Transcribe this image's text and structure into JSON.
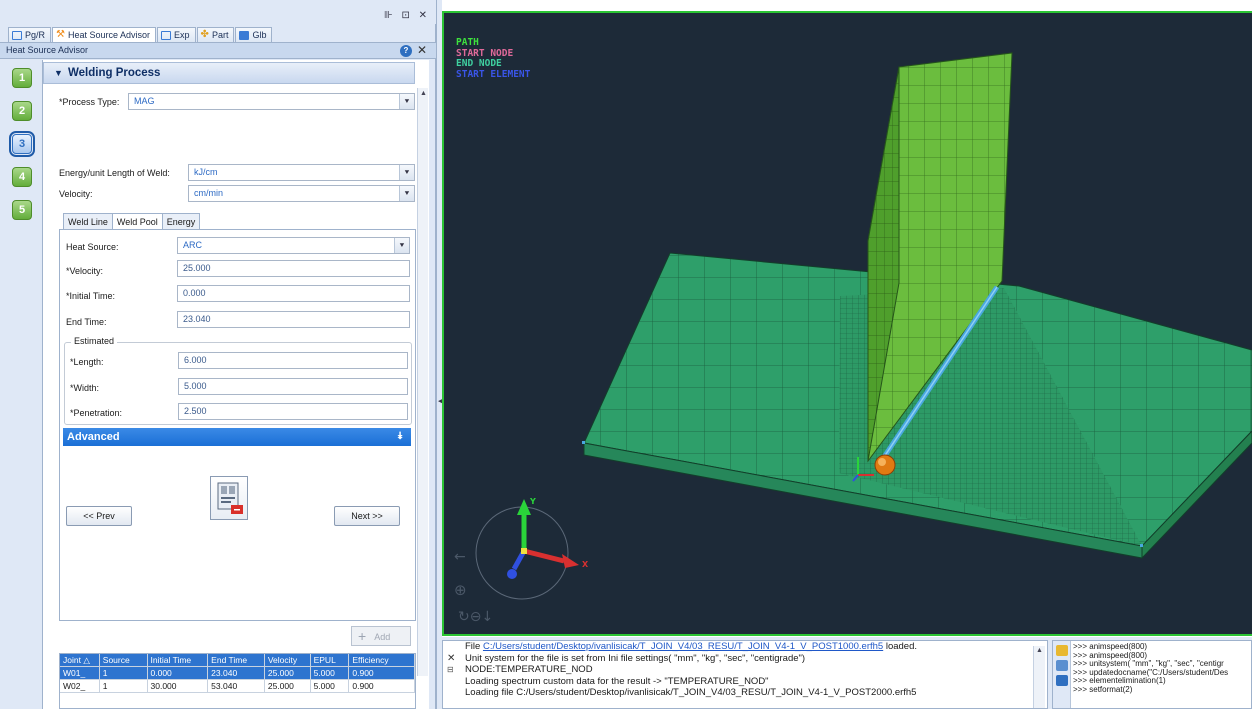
{
  "window_controls": "⊪ ⊡ ✕",
  "tabs": [
    {
      "label": "Pg/R",
      "icon": "tree-icon",
      "color": "#3a7bd5"
    },
    {
      "label": "Heat Source Advisor",
      "icon": "wand-icon",
      "color": "#f08c1a"
    },
    {
      "label": "Exp",
      "icon": "explorer-icon",
      "color": "#3a7bd5"
    },
    {
      "label": "Part",
      "icon": "part-icon",
      "color": "#e0a020"
    },
    {
      "label": "Glb",
      "icon": "globe-icon",
      "color": "#3a7bd5"
    }
  ],
  "advisor": {
    "title": "Heat Source Advisor",
    "help_glyph": "?",
    "close_glyph": "✕"
  },
  "steps": [
    "1",
    "2",
    "3",
    "4",
    "5"
  ],
  "welding_process": {
    "header": "Welding Process",
    "process_type_label": "*Process Type:",
    "process_type_value": "MAG",
    "energy_label": "Energy/unit Length of Weld:",
    "energy_unit": "kJ/cm",
    "velocity_label": "Velocity:",
    "velocity_unit": "cm/min"
  },
  "sub_tabs": [
    "Weld Line",
    "Weld Pool",
    "Energy"
  ],
  "weld_pool": {
    "heat_source_label": "Heat Source:",
    "heat_source_value": "ARC",
    "velocity_label": "*Velocity:",
    "velocity_value": "25.000",
    "initial_time_label": "*Initial Time:",
    "initial_time_value": "0.000",
    "end_time_label": "End Time:",
    "end_time_value": "23.040",
    "estimated_legend": "Estimated",
    "length_label": "*Length:",
    "length_value": "6.000",
    "width_label": "*Width:",
    "width_value": "5.000",
    "penetration_label": "*Penetration:",
    "penetration_value": "2.500"
  },
  "advanced": {
    "label": "Advanced",
    "expand_glyph": "⯯"
  },
  "nav": {
    "prev": "<< Prev",
    "next": "Next >>"
  },
  "add_label": "Add",
  "table": {
    "columns": [
      "Joint",
      "Source",
      "Initial Time",
      "End Time",
      "Velocity",
      "EPUL",
      "Efficiency"
    ],
    "rows": [
      [
        "W01_",
        "1",
        "0.000",
        "23.040",
        "25.000",
        "5.000",
        "0.900"
      ],
      [
        "W02_",
        "1",
        "30.000",
        "53.040",
        "25.000",
        "5.000",
        "0.900"
      ]
    ]
  },
  "viewport": {
    "legend": [
      {
        "text": "PATH",
        "color": "#3ee23e"
      },
      {
        "text": "START NODE",
        "color": "#e06a9a"
      },
      {
        "text": "END NODE",
        "color": "#3fd0a0"
      },
      {
        "text": "START ELEMENT",
        "color": "#3a55e8"
      }
    ],
    "axis_labels": {
      "x": "X",
      "y": "Y"
    },
    "colors": {
      "background": "#1d2a38",
      "mesh": "#2e9f6a",
      "mesh_light": "#5fbf3a",
      "weld_line": "#49a8e0"
    }
  },
  "console": {
    "lines": [
      {
        "prefix": "File ",
        "link": "C:/Users/student/Desktop/ivanlisicak/T_JOIN_V4/03_RESU/T_JOIN_V4-1_V_POST1000.erfh5",
        "suffix": " loaded."
      },
      {
        "prefix": "Unit system for the file is set from Ini file settings( \"mm\", \"kg\", \"sec\", \"centigrade\")",
        "link": "",
        "suffix": ""
      },
      {
        "prefix": "NODE:TEMPERATURE_NOD",
        "link": "",
        "suffix": ""
      },
      {
        "prefix": "Loading spectrum custom data for the result -> \"TEMPERATURE_NOD\"",
        "link": "",
        "suffix": ""
      },
      {
        "prefix": "Loading file C:/Users/student/Desktop/ivanlisicak/T_JOIN_V4/03_RESU/T_JOIN_V4-1_V_POST2000.erfh5",
        "link": "",
        "suffix": ""
      }
    ],
    "close_glyph": "✕",
    "pin_glyph": "⊟"
  },
  "history": [
    ">>> animspeed(800)",
    ">>> animspeed(800)",
    ">>> unitsystem( \"mm\", \"kg\", \"sec\", \"centigr",
    ">>> updatedocname(\"C:/Users/student/Des",
    ">>> elementelimination(1)",
    ">>> setformat(2)"
  ]
}
